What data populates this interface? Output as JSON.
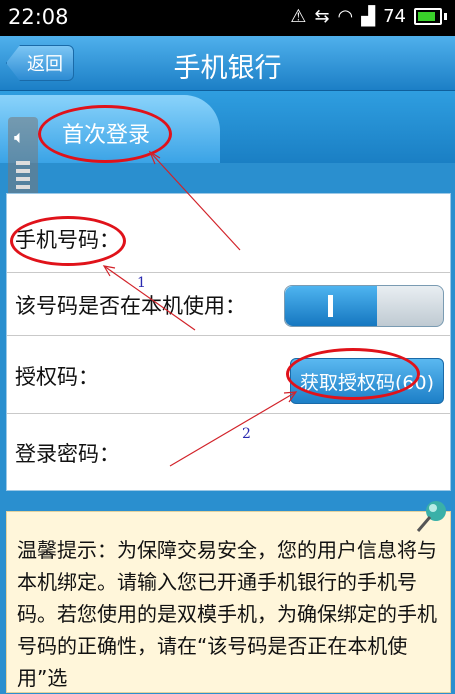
{
  "status_bar": {
    "time": "22:08",
    "battery": "74"
  },
  "header": {
    "back_label": "返回",
    "title": "手机银行"
  },
  "tabs": {
    "first_login": "首次登录"
  },
  "form": {
    "phone_label": "手机号码：",
    "device_label": "该号码是否在本机使用：",
    "auth_label": "授权码：",
    "get_code_label": "获取授权码(60)",
    "password_label": "登录密码："
  },
  "tips": {
    "text": "温馨提示：为保障交易安全，您的用户信息将与本机绑定。请输入您已开通手机银行的手机号码。若您使用的是双模手机，为确保绑定的手机号码的正确性，请在“该号码是否正在本机使用”选"
  },
  "annotations": {
    "label_1": "1",
    "label_2": "2"
  },
  "colors": {
    "accent": "#2a8fcf",
    "annotation": "#e0121a"
  }
}
